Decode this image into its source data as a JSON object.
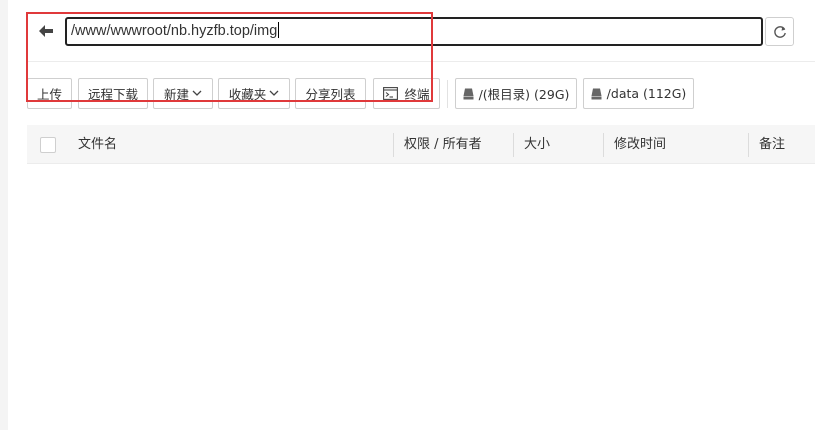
{
  "path_bar": {
    "path": "/www/wwwroot/nb.hyzfb.top/img"
  },
  "toolbar": {
    "upload": "上传",
    "remote_download": "远程下载",
    "new": "新建",
    "favorites": "收藏夹",
    "share_list": "分享列表",
    "terminal": "终端",
    "disk_root": "/(根目录) (29G)",
    "disk_data": "/data (112G)"
  },
  "table": {
    "columns": [
      "文件名",
      "权限 / 所有者",
      "大小",
      "修改时间",
      "备注"
    ]
  },
  "colors": {
    "annotation_red": "#e0393b",
    "header_bg": "#f6f6f6"
  }
}
